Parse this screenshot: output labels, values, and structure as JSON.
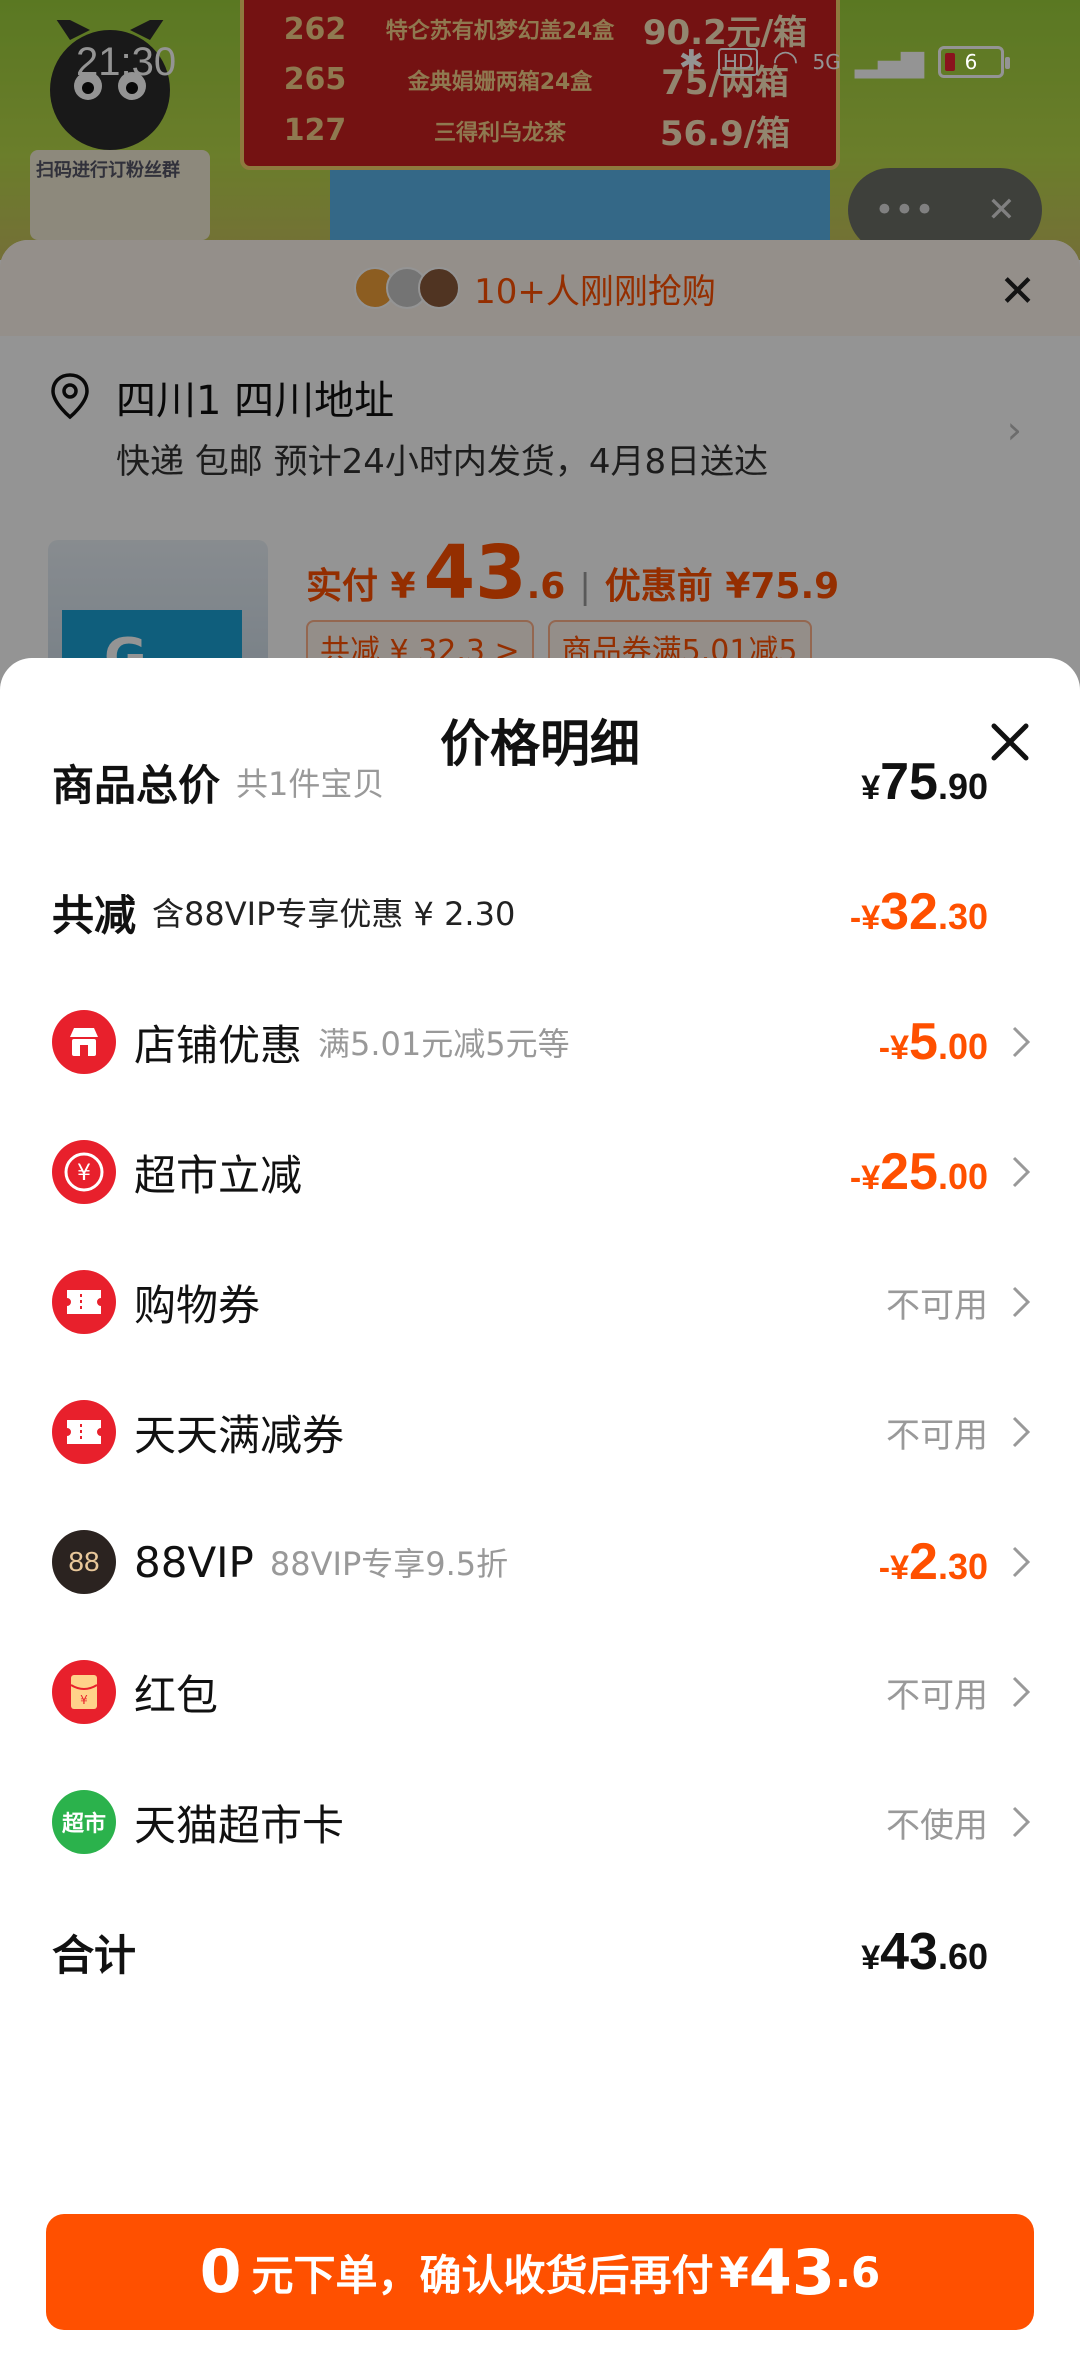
{
  "status_bar": {
    "time": "21:30",
    "network": "5G",
    "battery": "6"
  },
  "background": {
    "promo_table": [
      {
        "count": "262",
        "name": "特仑苏有机梦幻盖24盒",
        "price": "90.2元/箱"
      },
      {
        "count": "265",
        "name": "金典娟姗两箱24盒",
        "price": "75/两箱"
      },
      {
        "count": "127",
        "name": "三得利乌龙茶",
        "price": "56.9/箱"
      }
    ],
    "qr_label": "扫码进行订粉丝群",
    "grab_text": "10+人刚刚抢购",
    "address_name": "四川1 四川地址",
    "shipping": "快递 包邮 预计24小时内发货，4月8日送达",
    "pay_label": "实付 ¥",
    "pay_int": "43",
    "pay_dec": ".6",
    "before_price": "优惠前 ¥75.9",
    "chip_total": "共减 ¥ 32.3 >",
    "chip_coupon": "商品券满5.01减5",
    "product_letter": "G"
  },
  "panel": {
    "title": "价格明细",
    "rows": [
      {
        "title": "商品总价",
        "sub": "共1件宝贝",
        "yen": "¥",
        "int": "75",
        "dec": ".90"
      },
      {
        "title": "共减",
        "sub": "含88VIP专享优惠 ¥ 2.30",
        "sign": "-¥",
        "int": "32",
        "dec": ".30"
      },
      {
        "title": "店铺优惠",
        "sub": "满5.01元减5元等",
        "sign": "-¥",
        "int": "5",
        "dec": ".00"
      },
      {
        "title": "超市立减",
        "sub": "",
        "sign": "-¥",
        "int": "25",
        "dec": ".00"
      },
      {
        "title": "购物券",
        "status": "不可用"
      },
      {
        "title": "天天满减券",
        "status": "不可用"
      },
      {
        "title": "88VIP",
        "sub": "88VIP专享9.5折",
        "badge": "88",
        "sign": "-¥",
        "int": "2",
        "dec": ".30"
      },
      {
        "title": "红包",
        "status": "不可用"
      },
      {
        "title": "天猫超市卡",
        "badge": "超市",
        "status": "不使用"
      },
      {
        "title": "合计",
        "yen": "¥",
        "int": "43",
        "dec": ".60"
      }
    ],
    "cta": {
      "n": "0",
      "text": "元下单，确认收货后再付",
      "yen": "¥",
      "int": "43",
      "dec": ".6"
    }
  },
  "colors": {
    "accent": "#ff5000",
    "icon_red": "#e8202c"
  }
}
